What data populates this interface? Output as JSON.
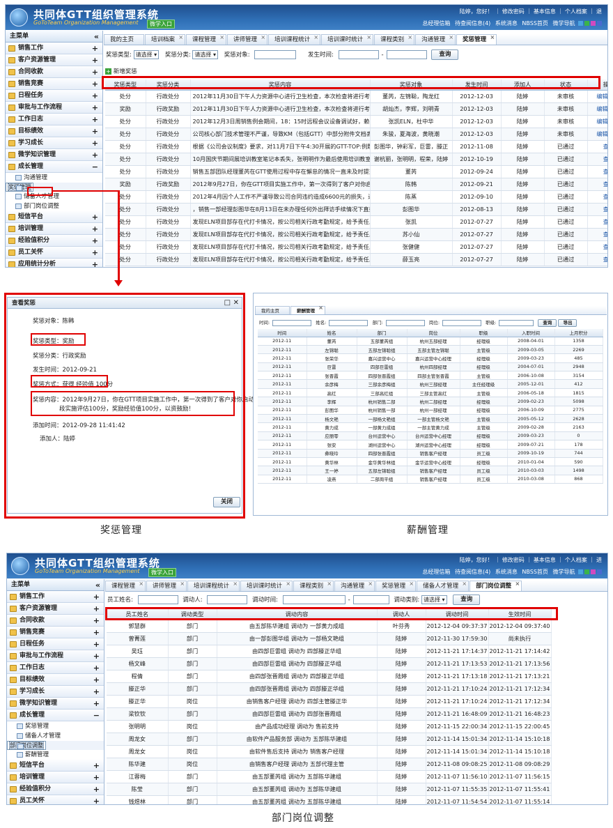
{
  "app": {
    "title": "共同体GTT组织管理系统",
    "subtitle": "GoToTeam Organization Management",
    "badge": "微学入口",
    "toplinks": "陆婷，您好！ ｜ 修改密码 ｜ 基本信息 ｜ 个人档案 ｜ 退",
    "toplinks2": "陆婷，您好！ ｜ 修改密码 ｜ 基本信息 ｜ 个人档案 ｜ 进",
    "notif": [
      "总经理信箱",
      "待查阅信息(4)",
      "系统消息",
      "NBSS首页",
      "微学导航"
    ]
  },
  "sidebar": {
    "title": "主菜单",
    "collapse": "«",
    "items_top": [
      "销售工作",
      "客户资源管理",
      "合同收款",
      "销售竞赛",
      "日程任务",
      "审批与工作流程",
      "工作日志",
      "目标绩效",
      "学习成长",
      "微学知识管理",
      "成长管理"
    ],
    "sub1": [
      "沟通管理",
      "奖惩管理",
      "储备人才管理",
      "部门岗位调整"
    ],
    "items_bottom": [
      "短信平台",
      "培训管理",
      "经验值积分",
      "员工关怀",
      "应用统计分析"
    ],
    "sub2": [
      "奖惩管理",
      "储备人才管理",
      "部门岗位调整",
      "薪酬管理"
    ]
  },
  "tabs1": [
    "我的主页",
    "培训档案",
    "课程管理",
    "讲师管理",
    "培训课程统计",
    "培训课时统计",
    "课程类别",
    "沟通管理",
    "奖惩管理"
  ],
  "filter1": {
    "type_label": "奖惩类型:",
    "type_val": "请选择",
    "cat_label": "奖惩分类:",
    "cat_val": "请选择",
    "obj_label": "奖惩对象:",
    "time_label": "发生时间:",
    "dash": "-",
    "query": "查询"
  },
  "add_label": "新增奖惩",
  "table1": {
    "headers": [
      "奖惩类型",
      "奖惩分类",
      "奖惩内容",
      "奖惩对象",
      "发生时间",
      "添加人",
      "状态",
      "操作"
    ],
    "rows": [
      [
        "处分",
        "行政处分",
        "2012年11月30日下午人力资源中心进行卫生检查，本次检查将进行考核与",
        "董芮，左锦聪，陶龙红",
        "2012-12-03",
        "陆婷",
        "未审核",
        "编辑 查看"
      ],
      [
        "奖励",
        "行政奖励",
        "2012年11月30日下午人力资源中心进行卫生检查，本次检查将进行考核与",
        "胡灿杰，李辉，刘明青",
        "2012-12-03",
        "陆婷",
        "未审核",
        "编辑 查看"
      ],
      [
        "处分",
        "行政处分",
        "2012年12月3日周销售例会期间，18：15时远程会议设备调试好，赖",
        "张凯ELN，杜中华",
        "2012-12-03",
        "陆婷",
        "未审核",
        "编辑 查看"
      ],
      [
        "处分",
        "行政处分",
        "公司核心部门技术管理不严谨，导致KM（包括GTT）中部分附件文档丢",
        "朱骏，夏海波，黄晓潮",
        "2012-12-03",
        "陆婷",
        "未审核",
        "编辑 查看"
      ],
      [
        "处分",
        "行政处分",
        "根据《公司会议制度》要求，对11月7日下午4:30开展的GTT-TOP:例题",
        "彭图华，钟彩军，巨雷，滕正",
        "2012-11-08",
        "陆婷",
        "已通过",
        "查看"
      ],
      [
        "处分",
        "行政处分",
        "10月国庆节期间展培训教室笔记本丢失，张明明作为最后使用培训教室人",
        "谢杭丽，张明明，程荣，陆婷",
        "2012-10-19",
        "陆婷",
        "已通过",
        "查看"
      ],
      [
        "处分",
        "行政处分",
        "销售五部团队经理董芮在GTT使用过程中存在懈怠的情况一直未及时提交",
        "董芮",
        "2012-09-24",
        "陆婷",
        "已通过",
        "查看"
      ],
      [
        "奖励",
        "行政奖励",
        "2012年9月27日，你在GTT项目实施工作中，第一次得到了客户对你启动",
        "陈韩",
        "2012-09-21",
        "陆婷",
        "已通过",
        "查看"
      ],
      [
        "处分",
        "行政处分",
        "2012年4月因个人工作不严谨导致公司合同违约造成6600元的损失，进行",
        "陈蒸",
        "2012-09-10",
        "陆婷",
        "已通过",
        "查看"
      ],
      [
        "处分",
        "行政处分",
        "，销售一部经理彭图华在8月13日在未办理任何外出拜访手续情况下直接去",
        "彭图华",
        "2012-08-13",
        "陆婷",
        "已通过",
        "查看"
      ],
      [
        "处分",
        "行政处分",
        "发现ELN项目部存在代打卡情况，按公司相关行政考勤规定，给予责任人",
        "张凯",
        "2012-07-27",
        "陆婷",
        "已通过",
        "查看"
      ],
      [
        "处分",
        "行政处分",
        "发现ELN项目部存在代打卡情况，按公司相关行政考勤规定，给予责任人",
        "苏小仙",
        "2012-07-27",
        "陆婷",
        "已通过",
        "查看"
      ],
      [
        "处分",
        "行政处分",
        "发现ELN项目部存在代打卡情况，按公司相关行政考勤规定，给予责任人",
        "张健健",
        "2012-07-27",
        "陆婷",
        "已通过",
        "查看"
      ],
      [
        "处分",
        "行政处分",
        "发现ELN项目部存在代打卡情况，按公司相关行政考勤规定，给予责任人",
        "薛玉亮",
        "2012-07-27",
        "陆婷",
        "已通过",
        "查看"
      ]
    ]
  },
  "dialog": {
    "title": "查看奖惩",
    "obj": "奖惩对象：陈韩",
    "type": "奖惩类型：奖励",
    "cat": "奖惩分类：行政奖励",
    "time": "发生时间：2012-09-21",
    "method": "奖惩方式：获得  经验值 100分",
    "content1": "奖惩内容：2012年9月27日，你在GTT项目实施工作中，第一次得到了客户对你启动阶",
    "content2": "段实施评估100分，奖励经验值100分，以资鼓励！",
    "addtime": "添加时间：2012-09-28 11:41:42",
    "adder": "添加人：陆婷",
    "close": "关闭"
  },
  "salary": {
    "tabs": [
      "我的主页",
      "薪酬管理"
    ],
    "filter": {
      "time": "时间:",
      "name": "姓名:",
      "dept": "部门:",
      "post": "岗位:",
      "level": "职级:",
      "query": "查询",
      "export": "导出"
    },
    "headers": [
      "时间",
      "姓名",
      "部门",
      "岗位",
      "职级",
      "入职时间",
      "上月积分"
    ],
    "rows": [
      [
        "2012-11",
        "董芮",
        "五部董芮组",
        "杭州五部经理",
        "经理级",
        "2008-04-01",
        "1358"
      ],
      [
        "2012-11",
        "左锦聪",
        "五部左锦聪组",
        "五部主管左锦聪",
        "主管级",
        "2009-03-05",
        "2269"
      ],
      [
        "2012-11",
        "张荣华",
        "嘉兴运营中心",
        "嘉兴运营中心经理",
        "经理级",
        "2009-03-23",
        "485"
      ],
      [
        "2012-11",
        "巨雷",
        "四部巨雷组",
        "杭州四部经理",
        "经理级",
        "2004-07-01",
        "2948"
      ],
      [
        "2012-11",
        "张晋霞",
        "四部张晋霞组",
        "四部主管张晋霞",
        "主管级",
        "2006-10-08",
        "3154"
      ],
      [
        "2012-11",
        "余彦梅",
        "三部余彦梅组",
        "杭州三部经理",
        "主任经理级",
        "2005-12-01",
        "412"
      ],
      [
        "2012-11",
        "高红",
        "三部高红组",
        "三部主管高红",
        "主管级",
        "2006-05-18",
        "1815"
      ],
      [
        "2012-11",
        "李辉",
        "杭州销售二部",
        "杭州二部经理",
        "经理级",
        "2009-02-23",
        "5098"
      ],
      [
        "2012-11",
        "彭图华",
        "杭州销售一部",
        "杭州一部经理",
        "经理级",
        "2006-10-09",
        "2775"
      ],
      [
        "2012-11",
        "杨文艳",
        "一部杨文艳组",
        "一部主管杨文艳",
        "主管级",
        "2005-05-12",
        "2628"
      ],
      [
        "2012-11",
        "黄力成",
        "一部黄力成组",
        "一部主管黄力成",
        "主管级",
        "2009-02-28",
        "2163"
      ],
      [
        "2012-11",
        "应丽零",
        "台州运营中心",
        "台州运营中心经理",
        "经理级",
        "2009-03-23",
        "0"
      ],
      [
        "2012-11",
        "张安",
        "湖州运营中心",
        "湖州运营中心经理",
        "经理级",
        "2009-07-21",
        "178"
      ],
      [
        "2012-11",
        "彝晓玲",
        "四部张晋霞组",
        "销售客户经理",
        "员工级",
        "2009-10-19",
        "744"
      ],
      [
        "2012-11",
        "黄华林",
        "金华黄华林组",
        "金华运营中心经理",
        "经理级",
        "2010-01-04",
        "590"
      ],
      [
        "2012-11",
        "王一婷",
        "五部左锦聪组",
        "销售客户经理",
        "员工级",
        "2010-03-03",
        "1498"
      ],
      [
        "2012-11",
        "凌燕",
        "二部周平组",
        "销售客户经理",
        "员工级",
        "2010-03-08",
        "868"
      ]
    ]
  },
  "captions": {
    "reward": "奖惩管理",
    "salary": "薪酬管理",
    "dept": "部门岗位调整"
  },
  "tabs3": [
    "课程管理",
    "讲师管理",
    "培训课程统计",
    "培训课时统计",
    "课程类别",
    "沟通管理",
    "奖惩管理",
    "储备人才管理",
    "部门岗位调整"
  ],
  "filter3": {
    "name": "员工姓名:",
    "by": "调动人:",
    "time": "调动时间:",
    "dash": "-",
    "cat": "调动类别:",
    "cat_val": "请选择",
    "query": "查询"
  },
  "table3": {
    "headers": [
      "员工姓名",
      "调动类型",
      "调动内容",
      "调动人",
      "调动时间",
      "生效时间"
    ],
    "rows": [
      [
        "郭慧群",
        "部门",
        "由五部陈华建组 调动为 一部黄力成组",
        "叶芬秀",
        "2012-12-04 09:37:37",
        "2012-12-04 09:37:40"
      ],
      [
        "曾菁莲",
        "部门",
        "由一部彭图华组 调动为 一部杨文艳组",
        "陆婷",
        "2012-11-30 17:59:30",
        "尚未执行"
      ],
      [
        "吴珏",
        "部门",
        "由四部巨雷组 调动为 四部滕正华组",
        "陆婷",
        "2012-11-21 17:14:37",
        "2012-11-21 17:14:42"
      ],
      [
        "杨文峰",
        "部门",
        "由四部巨雷组 调动为 四部滕正华组",
        "陆婷",
        "2012-11-21 17:13:53",
        "2012-11-21 17:13:56"
      ],
      [
        "程倩",
        "部门",
        "由四部张晋霞组 调动为 四部滕正华组",
        "陆婷",
        "2012-11-21 17:13:18",
        "2012-11-21 17:13:21"
      ],
      [
        "滕正华",
        "部门",
        "由四部张晋霞组 调动为 四部滕正华组",
        "陆婷",
        "2012-11-21 17:10:24",
        "2012-11-21 17:12:34"
      ],
      [
        "滕正华",
        "岗位",
        "由销售客户经理 调动为 四部主管滕正华",
        "陆婷",
        "2012-11-21 17:10:24",
        "2012-11-21 17:12:34"
      ],
      [
        "梁钦钦",
        "部门",
        "由四部巨雷组 调动为 四部张晋霞组",
        "陆婷",
        "2012-11-21 16:48:09",
        "2012-11-21 16:48:23"
      ],
      [
        "张明明",
        "岗位",
        "由产品成功经理 调动为 售前支持",
        "陆婷",
        "2012-11-15 22:00:34",
        "2012-11-15 22:00:45"
      ],
      [
        "周龙女",
        "部门",
        "由软件产品服务部 调动为 五部陈华建组",
        "陆婷",
        "2012-11-14 15:01:34",
        "2012-11-14 15:10:18"
      ],
      [
        "周龙女",
        "岗位",
        "由软件售后支持 调动为 销售客户经理",
        "陆婷",
        "2012-11-14 15:01:34",
        "2012-11-14 15:10:18"
      ],
      [
        "陈华建",
        "岗位",
        "由销售客户经理 调动为 五部代理主管",
        "陆婷",
        "2012-11-08 09:08:25",
        "2012-11-08 09:08:29"
      ],
      [
        "江蓉梅",
        "部门",
        "由五部董芮组 调动为 五部陈华建组",
        "陆婷",
        "2012-11-07 11:56:10",
        "2012-11-07 11:56:15"
      ],
      [
        "陈莹",
        "部门",
        "由五部董芮组 调动为 五部陈华建组",
        "陆婷",
        "2012-11-07 11:55:35",
        "2012-11-07 11:55:41"
      ],
      [
        "钱煜林",
        "部门",
        "由五部董芮组 调动为 五部陈华建组",
        "陆婷",
        "2012-11-07 11:54:54",
        "2012-11-07 11:55:14"
      ]
    ]
  }
}
